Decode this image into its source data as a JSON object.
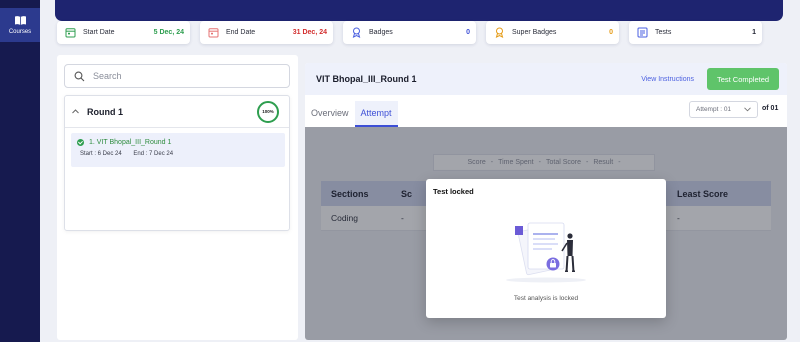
{
  "sidebar": {
    "items": [
      {
        "label": "Courses",
        "icon": "book-open-icon"
      }
    ]
  },
  "stats": [
    {
      "label": "Start Date",
      "value": "5 Dec, 24",
      "value_color": "#2e9e4f",
      "icon": "calendar-icon",
      "icon_color": "#2e9e4f"
    },
    {
      "label": "End Date",
      "value": "31 Dec, 24",
      "value_color": "#d32f2f",
      "icon": "calendar-icon",
      "icon_color": "#e57373"
    },
    {
      "label": "Badges",
      "value": "0",
      "value_color": "#3d4fd6",
      "icon": "badge-icon",
      "icon_color": "#4a5fe0"
    },
    {
      "label": "Super Badges",
      "value": "0",
      "value_color": "#e59b16",
      "icon": "super-badge-icon",
      "icon_color": "#e59b16"
    },
    {
      "label": "Tests",
      "value": "1",
      "value_color": "#1a1d2b",
      "icon": "tests-icon",
      "icon_color": "#4a5fe0"
    }
  ],
  "search": {
    "placeholder": "Search"
  },
  "round": {
    "title": "Round 1",
    "progress": "100%",
    "progress_fraction": 1.0,
    "test": {
      "name": "1. VIT Bhopal_III_Round 1",
      "start": "Start : 6 Dec 24",
      "end": "End : 7 Dec 24"
    }
  },
  "test_panel": {
    "title": "VIT Bhopal_III_Round 1",
    "view_instructions": "View Instructions",
    "status_button": "Test Completed",
    "tabs": [
      {
        "label": "Overview"
      },
      {
        "label": "Attempt"
      }
    ],
    "active_tab": "Attempt",
    "attempt_select": "Attempt : 01",
    "attempt_total": "of 01",
    "metrics": [
      "Score",
      "-",
      "Time Spent",
      "-",
      "Total Score",
      "-",
      "Result",
      "-"
    ],
    "table": {
      "headers": [
        "Sections",
        "Sc",
        "Least Score"
      ],
      "rows": [
        [
          "Coding",
          "-",
          "-"
        ]
      ]
    }
  },
  "modal": {
    "title": "Test locked",
    "message": "Test analysis is locked"
  },
  "colors": {
    "rail": "#161a4f",
    "banner": "#1e2470",
    "accent": "#3d4fd6",
    "success": "#5fc46a"
  }
}
